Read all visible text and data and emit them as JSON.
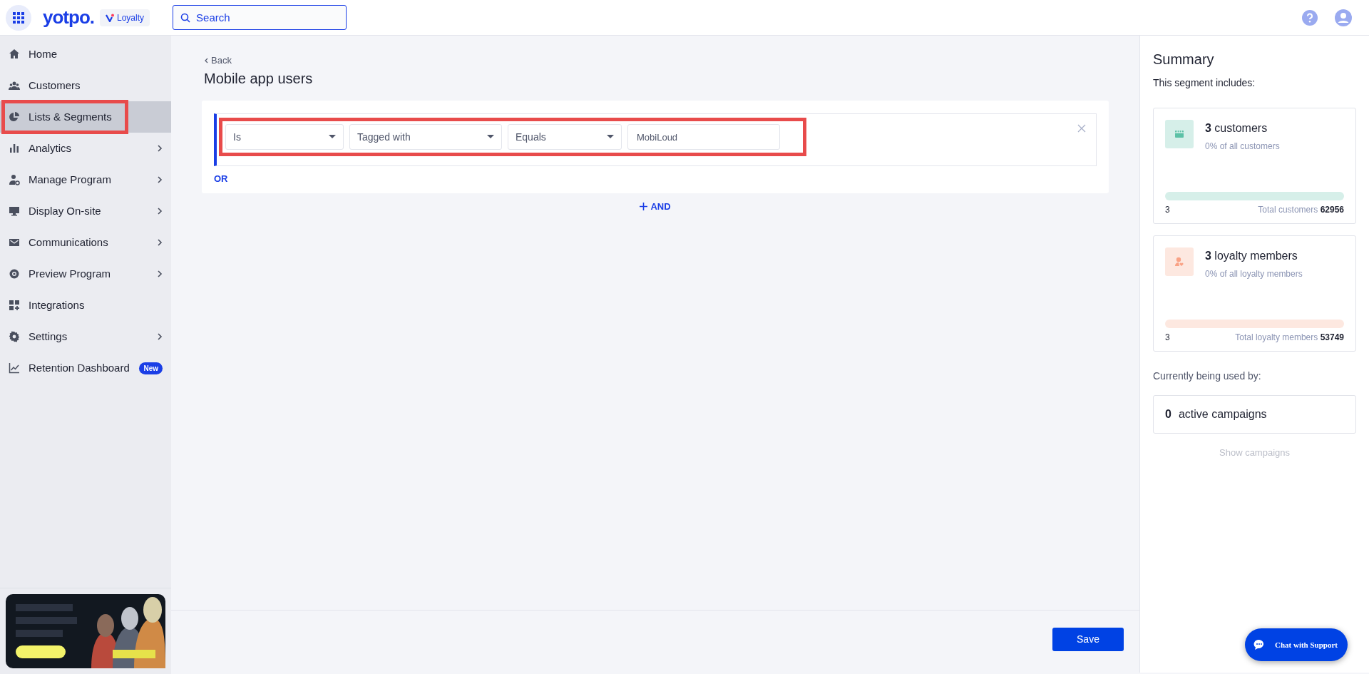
{
  "header": {
    "brand": "yotpo.",
    "product": "Loyalty",
    "search": {
      "placeholder": "Search"
    }
  },
  "sidebar": {
    "items": [
      {
        "label": "Home",
        "selected": false,
        "submenu": false
      },
      {
        "label": "Customers",
        "selected": false,
        "submenu": false
      },
      {
        "label": "Lists & Segments",
        "selected": true,
        "highlighted": true,
        "submenu": false
      },
      {
        "label": "Analytics",
        "selected": false,
        "submenu": true
      },
      {
        "label": "Manage Program",
        "selected": false,
        "submenu": true
      },
      {
        "label": "Display On-site",
        "selected": false,
        "submenu": true
      },
      {
        "label": "Communications",
        "selected": false,
        "submenu": true
      },
      {
        "label": "Preview Program",
        "selected": false,
        "submenu": true
      },
      {
        "label": "Integrations",
        "selected": false,
        "submenu": false
      },
      {
        "label": "Settings",
        "selected": false,
        "submenu": true
      },
      {
        "label": "Retention Dashboard",
        "selected": false,
        "submenu": false,
        "badge": "New"
      }
    ]
  },
  "main": {
    "back": "Back",
    "title": "Mobile app users",
    "condition": {
      "highlighted": true,
      "fields": [
        {
          "kind": "select",
          "value": "Is"
        },
        {
          "kind": "select",
          "value": "Tagged with"
        },
        {
          "kind": "select",
          "value": "Equals"
        },
        {
          "kind": "input",
          "value": "MobiLoud"
        }
      ]
    },
    "or": "OR",
    "and": "AND",
    "save": "Save"
  },
  "summary": {
    "title": "Summary",
    "subtitle": "This segment includes:",
    "cards": [
      {
        "count": "3",
        "label": "customers",
        "share": "0% of all customers",
        "min": "3",
        "total_label": "Total customers",
        "total": "62956",
        "level": 0,
        "color": "#5cc1a6"
      },
      {
        "count": "3",
        "label": "loyalty members",
        "share": "0% of all loyalty members",
        "min": "3",
        "total_label": "Total loyalty members",
        "total": "53749",
        "level": 0,
        "color": "#f9a285"
      }
    ],
    "used_by": "Currently being used by:",
    "campaigns_count": "0",
    "campaigns_label": "active campaigns",
    "show": "Show campaigns"
  },
  "chat": "Chat with Support"
}
